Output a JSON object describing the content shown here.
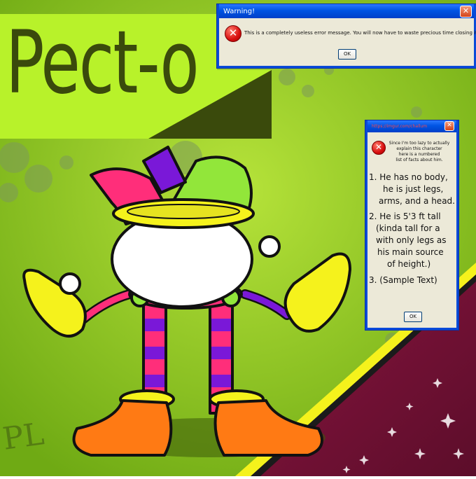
{
  "title": {
    "main": "Pect-",
    "tail": "o"
  },
  "warning_dialog": {
    "title": "Warning!",
    "close_glyph": "✕",
    "icon_glyph": "✕",
    "message": "This is a completely useless error message. You will now have to waste precious time closing it!",
    "ok_label": "OK"
  },
  "facts_dialog": {
    "title": "https://imgur.com/challum",
    "close_glyph": "✕",
    "icon_glyph": "✕",
    "intro_lines": [
      "Since I'm too lazy to actually",
      "explain this character",
      "here is a numbered",
      "list of facts about him."
    ],
    "fact_lines": [
      "1. He has no body,",
      "he is just legs,",
      "arms, and a head.",
      "2. He is 5'3 ft tall",
      "(kinda tall for a",
      "with only legs as",
      "his main source",
      "of height.)",
      "3. (Sample Text)"
    ],
    "ok_label": "OK"
  },
  "signature": "PL",
  "colors": {
    "bg_green": "#8ccc1c",
    "bg_lime": "#b8f22a",
    "title_dark": "#3a4a0c",
    "stripe_yellow": "#f5f21c",
    "maroon": "#7a1338",
    "xp_blue": "#0054e3",
    "xp_face": "#ece9d8"
  }
}
